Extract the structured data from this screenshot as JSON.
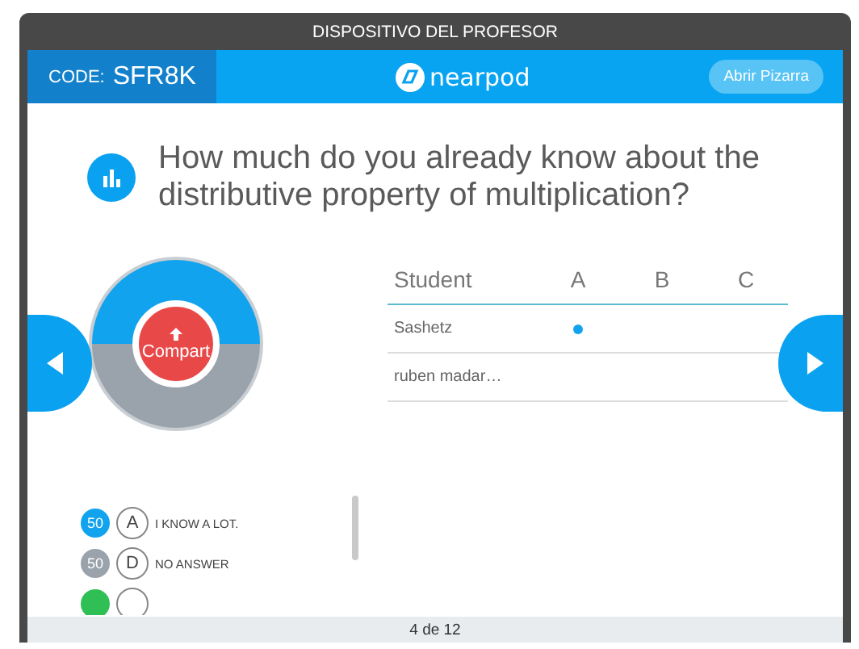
{
  "window": {
    "title": "DISPOSITIVO DEL PROFESOR"
  },
  "header": {
    "code_label": "CODE:",
    "code": "SFR8K",
    "logo": "nearpod",
    "button": "Abrir Pizarra"
  },
  "question": "How much do you already know about the distributive property of multiplication?",
  "share_button": "Compart",
  "answers": [
    {
      "count": "50",
      "letter": "A",
      "text": "I KNOW A LOT.",
      "color": "#12a3ee"
    },
    {
      "count": "50",
      "letter": "D",
      "text": "NO ANSWER",
      "color": "#9aa3ab"
    },
    {
      "color": "#2fbf55"
    }
  ],
  "table": {
    "columns": [
      "Student",
      "A",
      "B",
      "C"
    ],
    "rows": [
      {
        "name": "Sashetz",
        "answered": [
          true,
          false,
          false
        ]
      },
      {
        "name": "ruben madar…",
        "answered": [
          false,
          false,
          false
        ]
      }
    ]
  },
  "pager": "4 de 12"
}
